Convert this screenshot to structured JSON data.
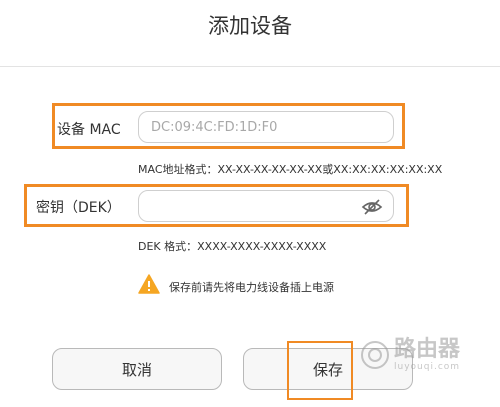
{
  "dialog": {
    "title": "添加设备"
  },
  "form": {
    "mac": {
      "label": "设备 MAC",
      "value": "DC:09:4C:FD:1D:F0",
      "hint": "MAC地址格式：XX-XX-XX-XX-XX-XX或XX:XX:XX:XX:XX:XX"
    },
    "dek": {
      "label": "密钥（DEK）",
      "value": "",
      "hint": "DEK 格式：XXXX-XXXX-XXXX-XXXX",
      "toggle_icon": "eye-hidden-icon"
    },
    "warning": {
      "text": "保存前请先将电力线设备插上电源",
      "icon": "warning-icon",
      "color": "#f5a623"
    }
  },
  "actions": {
    "cancel_label": "取消",
    "save_label": "保存"
  },
  "watermark": {
    "main": "路由器",
    "sub": "luyouqi.com"
  },
  "colors": {
    "highlight": "#f08a24"
  }
}
